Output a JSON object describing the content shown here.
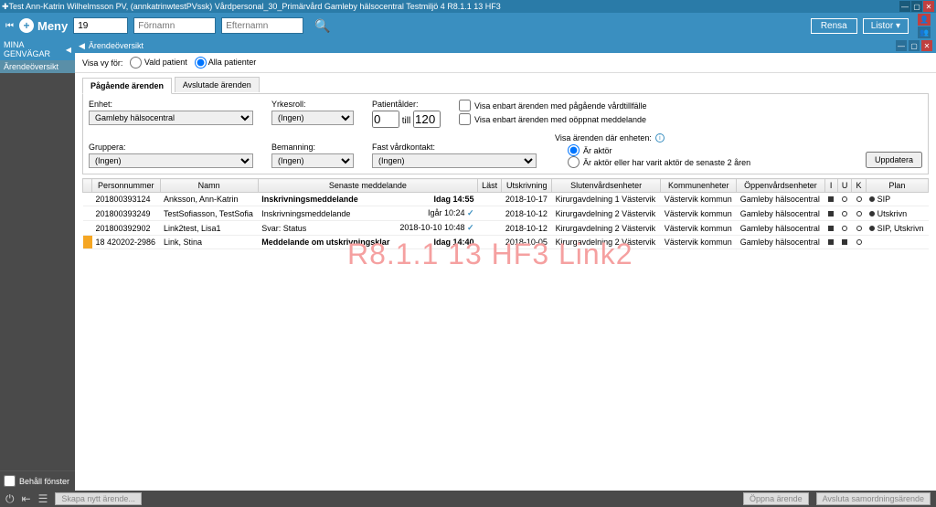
{
  "titlebar": {
    "text": "Test Ann-Katrin Wilhelmsson PV, (annkatrinwtestPVssk) Vårdpersonal_30_Primärvård Gamleby hälsocentral Testmiljö 4 R8.1.1 13 HF3"
  },
  "topbar": {
    "menu_label": "Meny",
    "search_value": "19",
    "placeholder_fornamn": "Förnamn",
    "placeholder_efternamn": "Efternamn",
    "btn_rensa": "Rensa",
    "btn_listor": "Listor ▾"
  },
  "sidebar": {
    "header": "MINA GENVÄGAR",
    "item_arende": "Ärendeöversikt",
    "keep_window": "Behåll fönster"
  },
  "panel": {
    "title": "Ärendeöversikt",
    "visa_label": "Visa vy för:",
    "radio_vald": "Vald patient",
    "radio_alla": "Alla patienter",
    "tab_pagaende": "Pågående ärenden",
    "tab_avslutade": "Avslutade ärenden",
    "lbl_enhet": "Enhet:",
    "val_enhet": "Gamleby hälsocentral",
    "lbl_yrkesroll": "Yrkesroll:",
    "val_ingen": "(Ingen)",
    "lbl_patientalder": "Patientålder:",
    "age_from": "0",
    "age_till_label": "till",
    "age_to": "120",
    "cb_visa_pagaende": "Visa enbart ärenden med pågående vårdtillfälle",
    "cb_visa_ooppnat": "Visa enbart ärenden med oöppnat meddelande",
    "lbl_gruppera": "Gruppera:",
    "lbl_bemanning": "Bemanning:",
    "lbl_fastvard": "Fast vårdkontakt:",
    "lbl_visa_arenden": "Visa ärenden där enheten:",
    "radio_ar_aktor": "Är aktör",
    "radio_har_varit": "Är aktör eller har varit aktör de senaste 2 åren",
    "btn_uppdatera": "Uppdatera"
  },
  "table": {
    "headers": {
      "personnummer": "Personnummer",
      "namn": "Namn",
      "senaste": "Senaste meddelande",
      "last": "Läst",
      "utskrivning": "Utskrivning",
      "sluten": "Slutenvårdsenheter",
      "kommun": "Kommunenheter",
      "oppen": "Öppenvårdsenheter",
      "i": "I",
      "u": "U",
      "k": "K",
      "plan": "Plan"
    },
    "rows": [
      {
        "pnr": "201800393124",
        "namn": "Anksson, Ann-Katrin",
        "medd": "Inskrivningsmeddelande",
        "medd_time": "Idag 14:55",
        "medd_bold": true,
        "last": "",
        "utskr": "2018-10-17",
        "sluten": "Kirurgavdelning 1 Västervik",
        "kommun": "Västervik kommun",
        "oppen": "Gamleby hälsocentral",
        "plan": "SIP"
      },
      {
        "pnr": "201800393249",
        "namn": "TestSofiasson, TestSofia",
        "medd": "Inskrivningsmeddelande",
        "medd_time": "Igår 10:24",
        "check": true,
        "last": "",
        "utskr": "2018-10-12",
        "sluten": "Kirurgavdelning 2 Västervik",
        "kommun": "Västervik kommun",
        "oppen": "Gamleby hälsocentral",
        "plan": "Utskrivn"
      },
      {
        "pnr": "201800392902",
        "namn": "Link2test, Lisa1",
        "medd": "Svar: Status",
        "medd_time": "2018-10-10 10:48",
        "check": true,
        "last": "",
        "utskr": "2018-10-12",
        "sluten": "Kirurgavdelning 2 Västervik",
        "kommun": "Västervik kommun",
        "oppen": "Gamleby hälsocentral",
        "plan": "SIP, Utskrivn"
      },
      {
        "pnr": "18 420202-2986",
        "namn": "Link, Stina",
        "medd": "Meddelande om utskrivningsklar",
        "medd_time": "Idag 14:40",
        "medd_bold": true,
        "last": "",
        "utskr": "2018-10-05",
        "sluten": "Kirurgavdelning 2 Västervik",
        "kommun": "Västervik kommun",
        "oppen": "Gamleby hälsocentral",
        "plan": "",
        "highlighted": true,
        "u_filled": true
      }
    ]
  },
  "watermark": "R8.1.1 13 HF3 Link2",
  "bottombar": {
    "btn_skapa": "Skapa nytt ärende...",
    "btn_oppna": "Öppna ärende",
    "btn_avsluta": "Avsluta samordningsärende"
  }
}
